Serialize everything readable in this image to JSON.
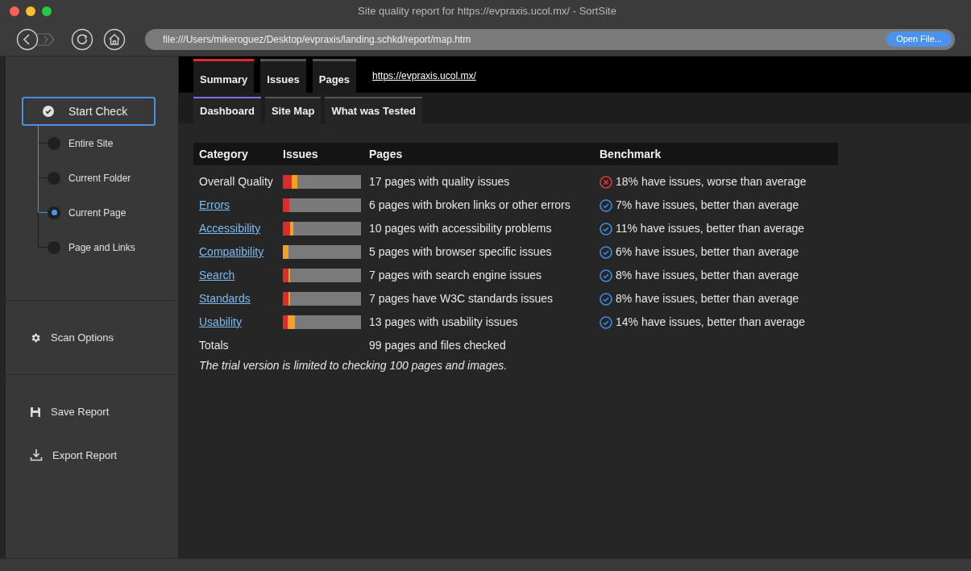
{
  "window": {
    "title": "Site quality report for https://evpraxis.ucol.mx/ - SortSite"
  },
  "toolbar": {
    "address": "file:///Users/mikeroguez/Desktop/evpraxis/landing.schkd/report/map.htm",
    "open_button": "Open File..."
  },
  "sidebar": {
    "start_button": "Start Check",
    "scopes": [
      {
        "label": "Entire Site",
        "selected": false
      },
      {
        "label": "Current Folder",
        "selected": false
      },
      {
        "label": "Current Page",
        "selected": true
      },
      {
        "label": "Page and Links",
        "selected": false
      }
    ],
    "scan_options": "Scan Options",
    "actions": [
      {
        "kind": "save",
        "label": "Save Report"
      },
      {
        "kind": "export",
        "label": "Export Report"
      }
    ]
  },
  "tabs": [
    {
      "label": "Summary",
      "selected": true
    },
    {
      "label": "Issues",
      "selected": false
    },
    {
      "label": "Pages",
      "selected": false
    }
  ],
  "site_link": "https://evpraxis.ucol.mx/",
  "subtabs": [
    {
      "label": "Dashboard",
      "selected": true
    },
    {
      "label": "Site Map",
      "selected": false
    },
    {
      "label": "What was Tested",
      "selected": false
    }
  ],
  "table": {
    "columns": [
      "Category",
      "Issues",
      "Pages",
      "Benchmark"
    ],
    "rows": [
      {
        "category": "Overall Quality",
        "link": false,
        "segments": [
          {
            "color": "#dd2a2a",
            "level": 0.11
          },
          {
            "color": "#f5a020",
            "level": 0.08
          }
        ],
        "pages": "17 pages with quality issues",
        "kind": "worse",
        "benchmark": "18% have issues, worse than average"
      },
      {
        "category": "Errors",
        "link": true,
        "segments": [
          {
            "color": "#dd2a2a",
            "level": 0.08
          }
        ],
        "pages": "6 pages with broken links or other errors",
        "kind": "better",
        "benchmark": "7% have issues, better than average"
      },
      {
        "category": "Accessibility",
        "link": true,
        "segments": [
          {
            "color": "#dd2a2a",
            "level": 0.09
          },
          {
            "color": "#f5a020",
            "level": 0.04
          }
        ],
        "pages": "10 pages with accessibility problems",
        "kind": "better",
        "benchmark": "11% have issues, better than average"
      },
      {
        "category": "Compatibility",
        "link": true,
        "segments": [
          {
            "color": "#f5a020",
            "level": 0.07
          }
        ],
        "pages": "5 pages with browser specific issues",
        "kind": "better",
        "benchmark": "6% have issues, better than average"
      },
      {
        "category": "Search",
        "link": true,
        "segments": [
          {
            "color": "#dd2a2a",
            "level": 0.07
          },
          {
            "color": "#f5a020",
            "level": 0.02
          }
        ],
        "pages": "7 pages with search engine issues",
        "kind": "better",
        "benchmark": "8% have issues, better than average"
      },
      {
        "category": "Standards",
        "link": true,
        "segments": [
          {
            "color": "#dd2a2a",
            "level": 0.07
          },
          {
            "color": "#f5a020",
            "level": 0.02
          }
        ],
        "pages": "7 pages have W3C standards issues",
        "kind": "better",
        "benchmark": "8% have issues, better than average"
      },
      {
        "category": "Usability",
        "link": true,
        "segments": [
          {
            "color": "#dd2a2a",
            "level": 0.06
          },
          {
            "color": "#f5a020",
            "level": 0.09
          }
        ],
        "pages": "13 pages with usability issues",
        "kind": "better",
        "benchmark": "14% have issues, better than average"
      }
    ],
    "totals": {
      "label": "Totals",
      "pages": "99 pages and files checked"
    }
  },
  "note": "The trial version is limited to checking 100 pages and images."
}
